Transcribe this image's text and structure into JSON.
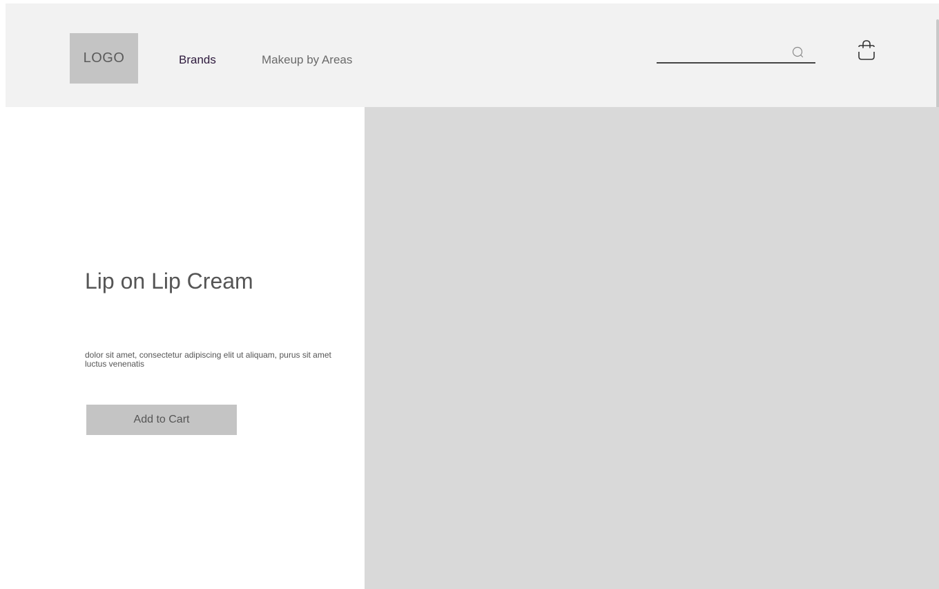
{
  "header": {
    "logo_text": "LOGO",
    "nav": [
      {
        "label": "Brands"
      },
      {
        "label": "Makeup by Areas"
      }
    ],
    "search": {
      "value": "",
      "placeholder": "",
      "icon": "search-icon"
    },
    "cart_icon": "shopping-bag-icon"
  },
  "product": {
    "title": "Lip on Lip Cream",
    "description": "dolor sit amet, consectetur adipiscing elit ut aliquam, purus sit amet luctus venenatis",
    "add_to_cart_label": "Add to Cart"
  },
  "colors": {
    "header_bg": "#f2f2f2",
    "placeholder_gray": "#c4c4c4",
    "image_bg": "#d9d9d9",
    "active_nav": "#2e1a3d",
    "text_gray": "#555555"
  }
}
